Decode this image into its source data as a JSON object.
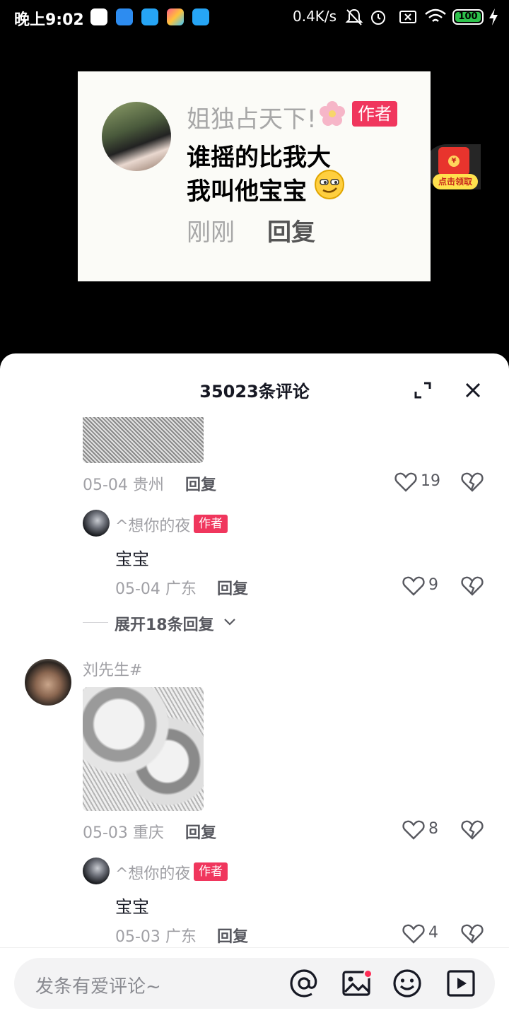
{
  "status_bar": {
    "time": "晚上9:02",
    "net_speed": "0.4K/s",
    "battery": "100"
  },
  "video_card": {
    "name": "姐独占天下!",
    "author_badge": "作者",
    "line1": "谁摇的比我大",
    "line2": "我叫他宝宝",
    "time": "刚刚",
    "reply": "回复"
  },
  "red_packet": {
    "label": "点击领取"
  },
  "sheet": {
    "title": "35023条评论",
    "comments": [
      {
        "meta": "05-04 贵州",
        "reply": "回复",
        "likes": "19",
        "replies": [
          {
            "user": "^想你的夜",
            "badge": "作者",
            "text": "宝宝",
            "meta": "05-04 广东",
            "reply": "回复",
            "likes": "9"
          }
        ],
        "expand": "展开18条回复"
      },
      {
        "user": "刘先生#",
        "meta": "05-03 重庆",
        "reply": "回复",
        "likes": "8",
        "replies": [
          {
            "user": "^想你的夜",
            "badge": "作者",
            "text": "宝宝",
            "meta": "05-03 广东",
            "reply": "回复",
            "likes": "4"
          }
        ]
      }
    ]
  },
  "input": {
    "placeholder": "发条有爱评论~"
  },
  "colors": {
    "accent": "#fe2c55",
    "author_badge": "#f0365d"
  }
}
